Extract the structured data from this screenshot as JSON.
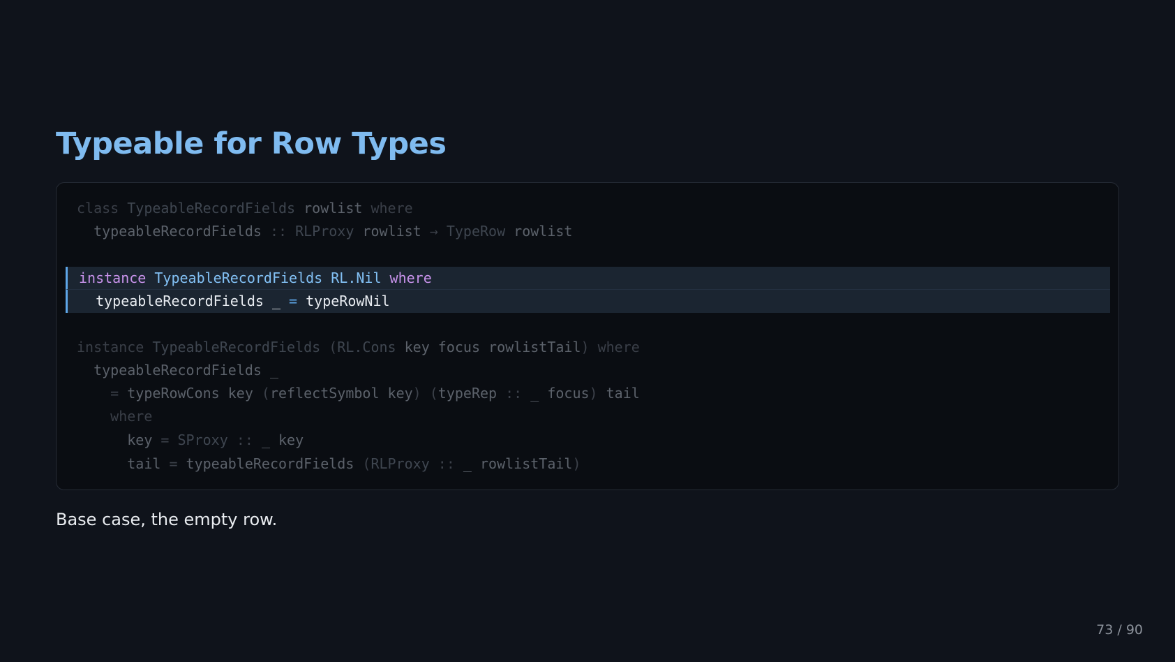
{
  "slide": {
    "title": "Typeable for Row Types",
    "caption": "Base case, the empty row.",
    "page_counter": "73 / 90"
  },
  "code": {
    "lines": [
      {
        "highlighted": false,
        "tokens": [
          {
            "t": "class ",
            "k": "kw"
          },
          {
            "t": "TypeableRecordFields ",
            "k": "ty"
          },
          {
            "t": "rowlist ",
            "k": "id"
          },
          {
            "t": "where",
            "k": "kw"
          }
        ]
      },
      {
        "highlighted": false,
        "tokens": [
          {
            "t": "  typeableRecordFields ",
            "k": "id"
          },
          {
            "t": ":: ",
            "k": "op"
          },
          {
            "t": "RLProxy ",
            "k": "ty"
          },
          {
            "t": "rowlist ",
            "k": "id"
          },
          {
            "t": "→ ",
            "k": "op"
          },
          {
            "t": "TypeRow ",
            "k": "ty"
          },
          {
            "t": "rowlist",
            "k": "id"
          }
        ]
      },
      {
        "highlighted": false,
        "tokens": []
      },
      {
        "highlighted": true,
        "tokens": [
          {
            "t": "instance ",
            "k": "kw"
          },
          {
            "t": "TypeableRecordFields ",
            "k": "ty"
          },
          {
            "t": "RL.Nil ",
            "k": "ty"
          },
          {
            "t": "where",
            "k": "kw"
          }
        ]
      },
      {
        "highlighted": true,
        "tokens": [
          {
            "t": "  typeableRecordFields _ ",
            "k": "id"
          },
          {
            "t": "= ",
            "k": "op"
          },
          {
            "t": "typeRowNil",
            "k": "id"
          }
        ]
      },
      {
        "highlighted": false,
        "tokens": []
      },
      {
        "highlighted": false,
        "tokens": [
          {
            "t": "instance ",
            "k": "kw"
          },
          {
            "t": "TypeableRecordFields ",
            "k": "ty"
          },
          {
            "t": "(",
            "k": "op"
          },
          {
            "t": "RL.Cons ",
            "k": "ty"
          },
          {
            "t": "key focus rowlistTail",
            "k": "id"
          },
          {
            "t": ") ",
            "k": "op"
          },
          {
            "t": "where",
            "k": "kw"
          }
        ]
      },
      {
        "highlighted": false,
        "tokens": [
          {
            "t": "  typeableRecordFields _",
            "k": "id"
          }
        ]
      },
      {
        "highlighted": false,
        "tokens": [
          {
            "t": "    ",
            "k": "id"
          },
          {
            "t": "= ",
            "k": "op"
          },
          {
            "t": "typeRowCons key ",
            "k": "id"
          },
          {
            "t": "(",
            "k": "op"
          },
          {
            "t": "reflectSymbol key",
            "k": "id"
          },
          {
            "t": ") (",
            "k": "op"
          },
          {
            "t": "typeRep ",
            "k": "id"
          },
          {
            "t": ":: ",
            "k": "op"
          },
          {
            "t": "_ focus",
            "k": "id"
          },
          {
            "t": ") ",
            "k": "op"
          },
          {
            "t": "tail",
            "k": "id"
          }
        ]
      },
      {
        "highlighted": false,
        "tokens": [
          {
            "t": "    ",
            "k": "id"
          },
          {
            "t": "where",
            "k": "kw"
          }
        ]
      },
      {
        "highlighted": false,
        "tokens": [
          {
            "t": "      key ",
            "k": "id"
          },
          {
            "t": "= ",
            "k": "op"
          },
          {
            "t": "SProxy ",
            "k": "ty"
          },
          {
            "t": ":: ",
            "k": "op"
          },
          {
            "t": "_ key",
            "k": "id"
          }
        ]
      },
      {
        "highlighted": false,
        "tokens": [
          {
            "t": "      tail ",
            "k": "id"
          },
          {
            "t": "= ",
            "k": "op"
          },
          {
            "t": "typeableRecordFields ",
            "k": "id"
          },
          {
            "t": "(",
            "k": "op"
          },
          {
            "t": "RLProxy ",
            "k": "ty"
          },
          {
            "t": ":: ",
            "k": "op"
          },
          {
            "t": "_ rowlistTail",
            "k": "id"
          },
          {
            "t": ")",
            "k": "op"
          }
        ]
      }
    ]
  },
  "colors": {
    "background": "#0f131b",
    "title": "#7fbbf0",
    "highlight_bar": "#5ea6e8",
    "keyword": "#c792ea",
    "type": "#82c0f4"
  }
}
